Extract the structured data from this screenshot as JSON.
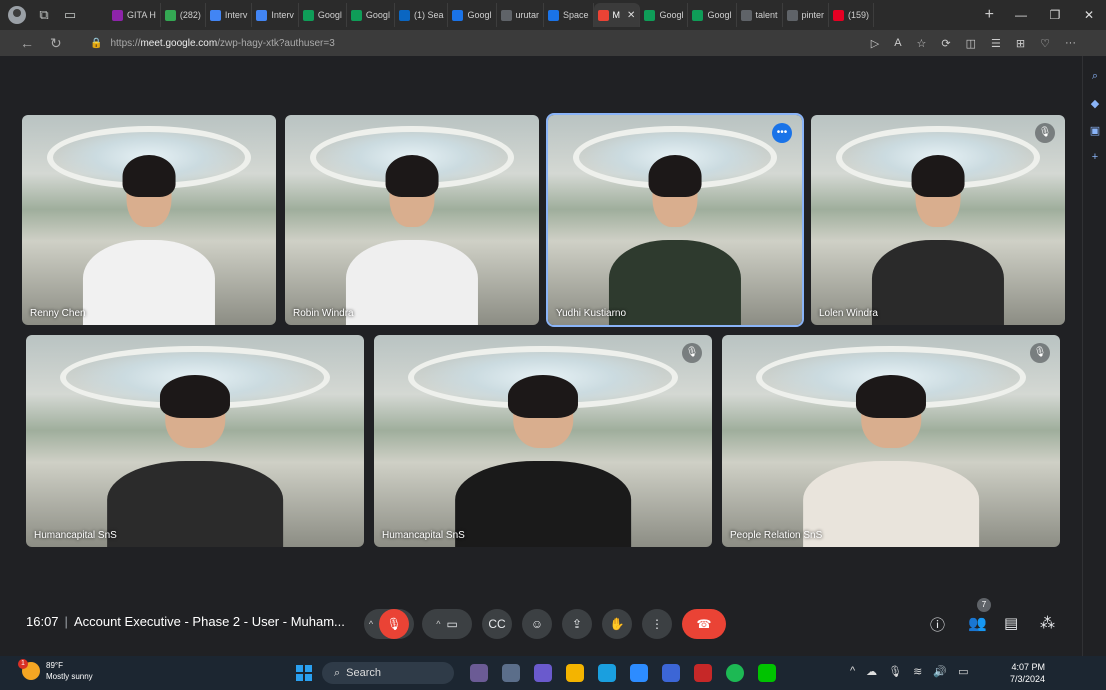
{
  "browser": {
    "tabs": [
      {
        "label": "GITA H",
        "color": "#8e24aa"
      },
      {
        "label": "(282)",
        "color": "#34a853"
      },
      {
        "label": "Interv",
        "color": "#4285f4"
      },
      {
        "label": "Interv",
        "color": "#4285f4"
      },
      {
        "label": "Googl",
        "color": "#0f9d58"
      },
      {
        "label": "Googl",
        "color": "#0f9d58"
      },
      {
        "label": "(1) Sea",
        "color": "#0a66c2"
      },
      {
        "label": "Googl",
        "color": "#1a73e8"
      },
      {
        "label": "urutar",
        "color": "#5f6368"
      },
      {
        "label": "Space",
        "color": "#1a73e8"
      },
      {
        "label": "M",
        "color": "#ea4335",
        "active": true
      },
      {
        "label": "Googl",
        "color": "#0f9d58"
      },
      {
        "label": "Googl",
        "color": "#0f9d58"
      },
      {
        "label": "talent",
        "color": "#5f6368"
      },
      {
        "label": "pinter",
        "color": "#5f6368"
      },
      {
        "label": "(159)",
        "color": "#e60023"
      }
    ],
    "url_prefix": "https://",
    "url_host": "meet.google.com",
    "url_path": "/zwp-hagy-xtk?authuser=3"
  },
  "participants": [
    {
      "name": "Renny Chen",
      "muted": false
    },
    {
      "name": "Robin Windra",
      "muted": false
    },
    {
      "name": "Yudhi Kustiarno",
      "speaking": true
    },
    {
      "name": "Lolen Windra",
      "muted": true
    },
    {
      "name": "Humancapital SnS",
      "muted": false
    },
    {
      "name": "Humancapital SnS",
      "muted": true
    },
    {
      "name": "People Relation SnS",
      "muted": true
    }
  ],
  "meeting": {
    "time": "16:07",
    "title": "Account Executive - Phase 2 - User - Muham...",
    "people_count": "7"
  },
  "taskbar": {
    "temperature": "89°F",
    "weather": "Mostly sunny",
    "weather_badge": "1",
    "search_placeholder": "Search",
    "time": "4:07 PM",
    "date": "7/3/2024"
  }
}
